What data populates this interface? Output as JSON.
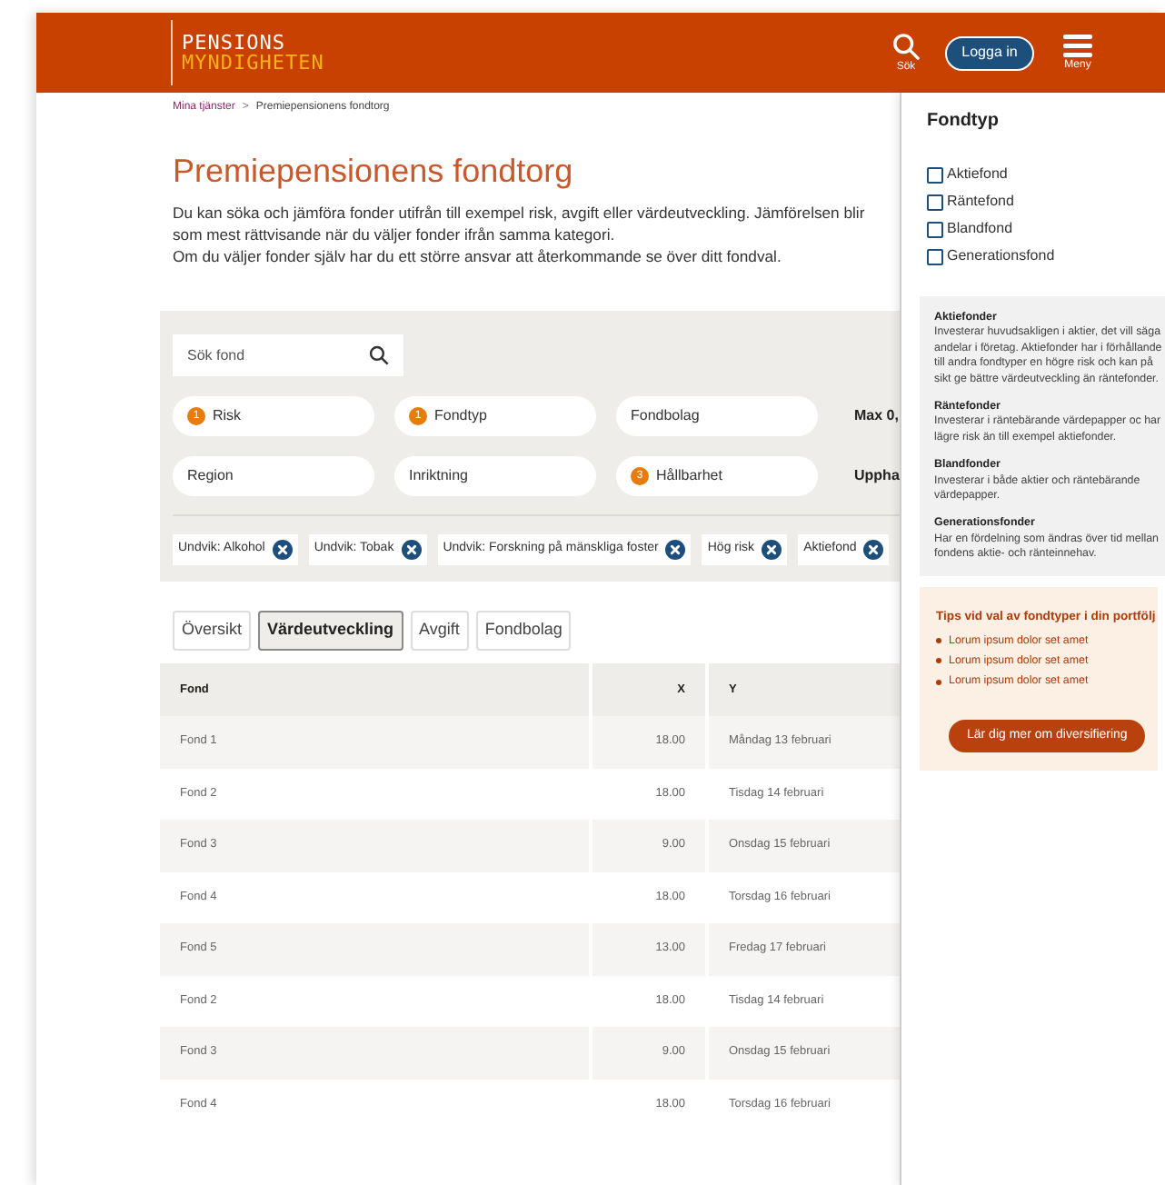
{
  "header": {
    "logo_line1": "PENSIONS",
    "logo_line2": "MYNDIGHETEN",
    "search_label": "Sök",
    "login_button": "Logga in",
    "menu_label": "Meny"
  },
  "breadcrumb": [
    {
      "label": "Mina tjänster",
      "kind": "link"
    },
    {
      "label": ">",
      "kind": "separator"
    },
    {
      "label": "Premiepensionens fondtorg",
      "kind": "current"
    }
  ],
  "title": "Premiepensionens fondtorg",
  "intro": [
    "Du kan söka och jämföra fonder utifrån till exempel risk, avgift eller värdeutveckling. Jämförelsen blir som mest rättvisande när du väljer fonder ifrån samma kategori.",
    "Om du väljer fonder själv har du ett större ansvar att återkommande se över ditt fondval."
  ],
  "search": {
    "placeholder": "Sök fond"
  },
  "filters": [
    {
      "label": "Risk",
      "count": "1"
    },
    {
      "label": "Fondtyp",
      "count": "1"
    },
    {
      "label": "Fondbolag"
    },
    {
      "label": "Region"
    },
    {
      "label": "Inriktning"
    },
    {
      "label": "Hållbarhet",
      "count": "3"
    }
  ],
  "filter_side_labels": [
    "Max 0,",
    "Uppha"
  ],
  "active_tags": [
    "Undvik: Alkohol",
    "Undvik: Tobak",
    "Undvik: Forskning på mänskliga foster",
    "Hög risk",
    "Aktiefond"
  ],
  "tabs": [
    {
      "label": "Översikt",
      "selected": false
    },
    {
      "label": "Värdeutveckling",
      "selected": true
    },
    {
      "label": "Avgift",
      "selected": false
    },
    {
      "label": "Fondbolag",
      "selected": false
    }
  ],
  "table": {
    "columns": [
      "Fond",
      "X",
      "Y"
    ],
    "rows": [
      [
        "Fond 1",
        "18.00",
        "Måndag 13 februari"
      ],
      [
        "Fond 2",
        "18.00",
        "Tisdag 14 februari"
      ],
      [
        "Fond 3",
        "9.00",
        "Onsdag 15 februari"
      ],
      [
        "Fond 4",
        "18.00",
        "Torsdag 16 februari"
      ],
      [
        "Fond 5",
        "13.00",
        "Fredag 17 februari"
      ],
      [
        "Fond 2",
        "18.00",
        "Tisdag 14 februari"
      ],
      [
        "Fond 3",
        "9.00",
        "Onsdag 15 februari"
      ],
      [
        "Fond 4",
        "18.00",
        "Torsdag 16 februari"
      ]
    ]
  },
  "sidebar": {
    "title": "Fondtyp",
    "options": [
      {
        "label": "Aktiefond",
        "checked": false
      },
      {
        "label": "Räntefond",
        "checked": false
      },
      {
        "label": "Blandfond",
        "checked": false
      },
      {
        "label": "Generationsfond",
        "checked": false
      }
    ],
    "info": [
      {
        "heading": "Aktiefonder",
        "text": "Investerar huvudsakligen i aktier, det vill säga andelar i företag. Aktiefonder har i förhållande till andra fondtyper en högre risk och kan på sikt ge bättre värdeutveckling än räntefonder."
      },
      {
        "heading": "Räntefonder",
        "text": "Investerar i räntebärande värdepapper oc har lägre risk än till exempel aktiefonder."
      },
      {
        "heading": "Blandfonder",
        "text": "Investerar i både aktier och räntebärande värdepapper."
      },
      {
        "heading": "Generationsfonder",
        "text": "Har en fördelning som ändras över tid mellan fondens aktie- och ränteinnehav."
      }
    ],
    "tips": {
      "title": "Tips vid val av fondtyper i din portfölj",
      "items": [
        "Lorum ipsum dolor set amet",
        "Lorum ipsum dolor set amet",
        "Lorum ipsum dolor set amet"
      ],
      "button": "Lär dig mer om diversifiering"
    }
  }
}
